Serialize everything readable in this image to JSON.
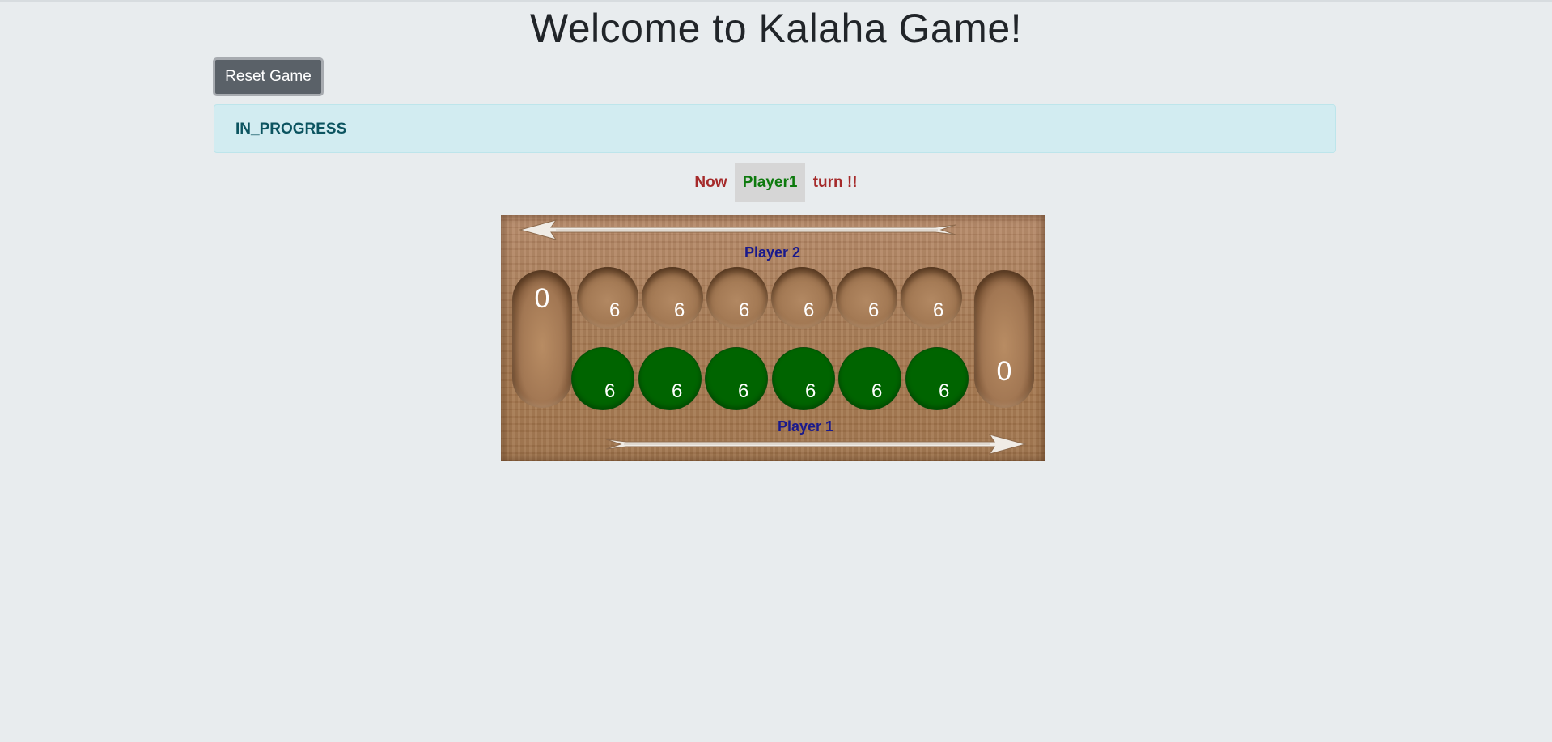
{
  "page": {
    "title": "Welcome to Kalaha Game!",
    "reset_label": "Reset Game",
    "status": "IN_PROGRESS"
  },
  "turn": {
    "prefix": "Now",
    "player": "Player1",
    "suffix": "turn !!"
  },
  "board": {
    "player2_label": "Player 2",
    "player1_label": "Player 1",
    "player2_store": "0",
    "player1_store": "0",
    "player2_pits": [
      "6",
      "6",
      "6",
      "6",
      "6",
      "6"
    ],
    "player1_pits": [
      "6",
      "6",
      "6",
      "6",
      "6",
      "6"
    ],
    "active_pit_color": "#006400",
    "label_color": "#1a1a8c"
  }
}
